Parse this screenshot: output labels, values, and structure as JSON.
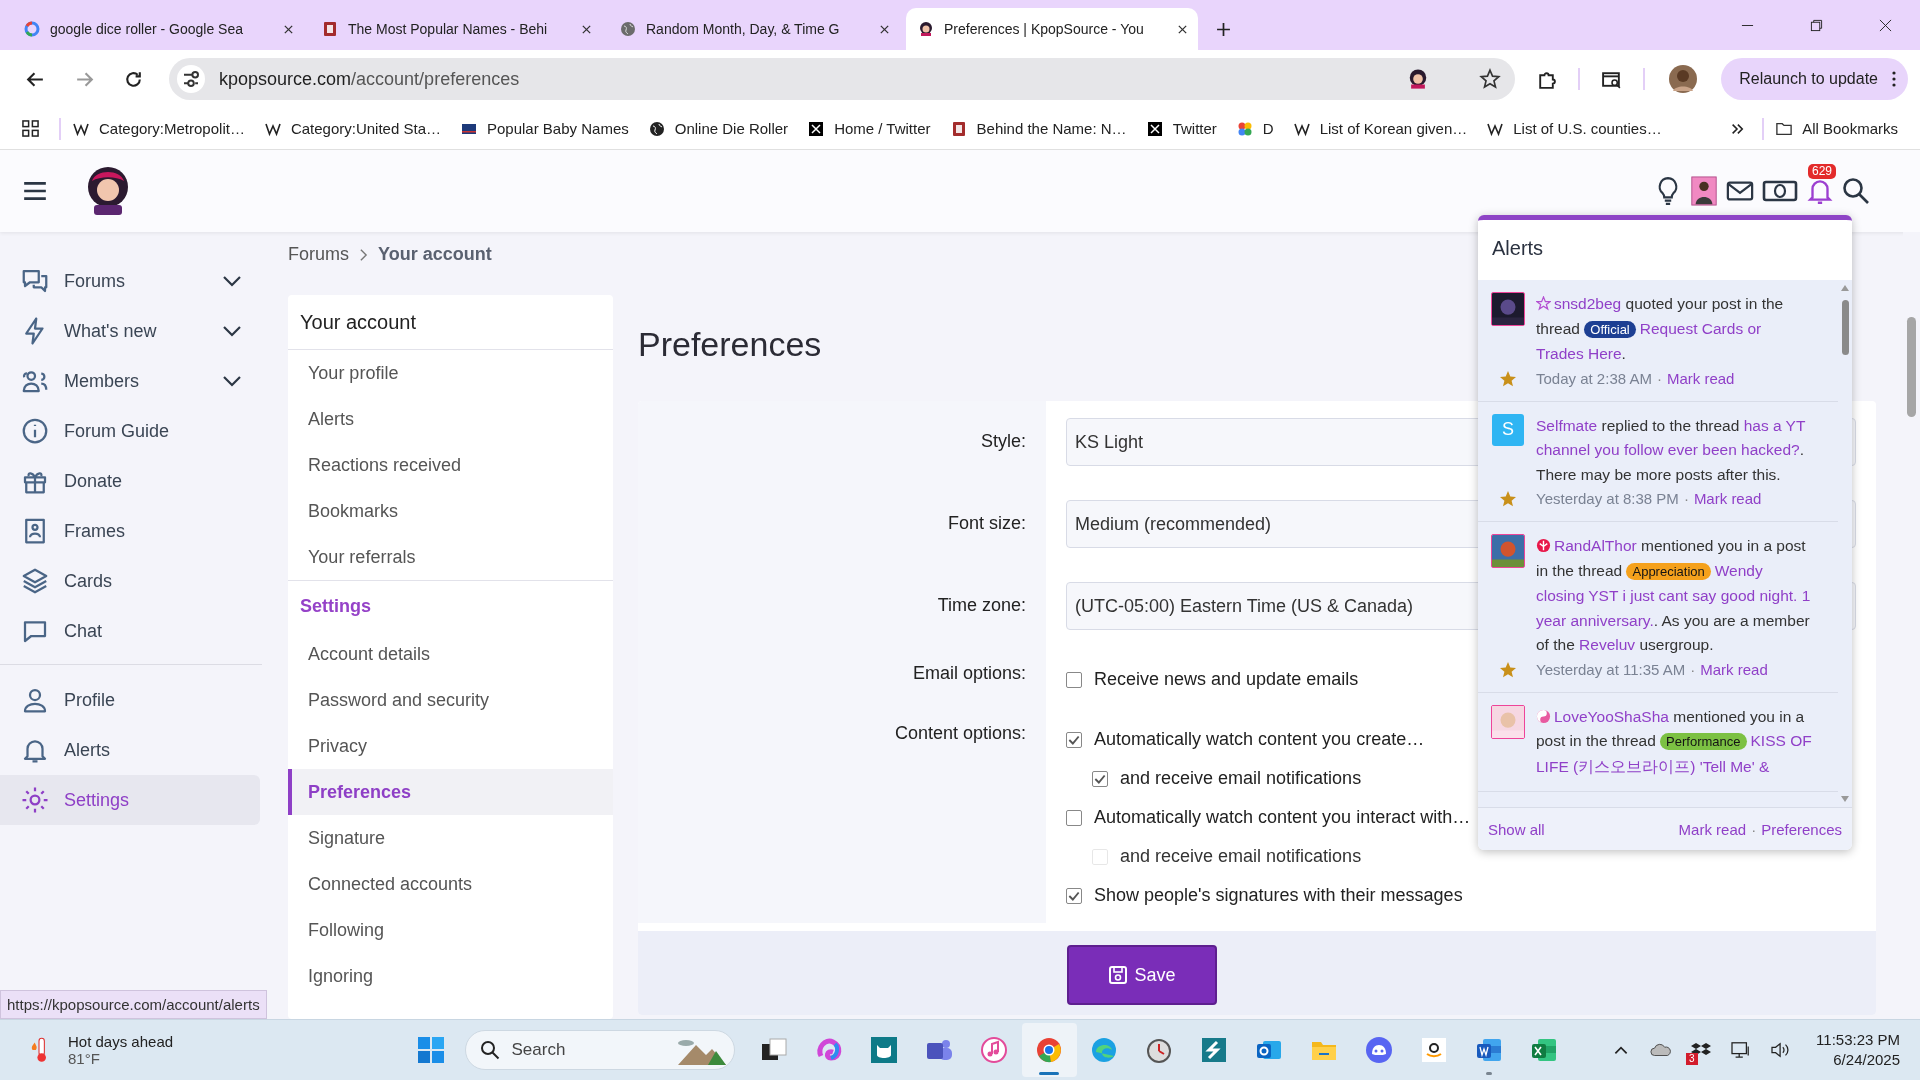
{
  "browser": {
    "tabs": [
      {
        "title": "google dice roller - Google Sea",
        "selected": false
      },
      {
        "title": "The Most Popular Names - Behi",
        "selected": false
      },
      {
        "title": "Random Month, Day, & Time G",
        "selected": false
      },
      {
        "title": "Preferences | KpopSource - You",
        "selected": true
      }
    ],
    "address": {
      "host": "kpopsource.com",
      "path": "/account/preferences"
    },
    "relaunch": "Relaunch to update",
    "bookmarks": [
      {
        "label": "Category:Metropolit…"
      },
      {
        "label": "Category:United Sta…"
      },
      {
        "label": "Popular Baby Names"
      },
      {
        "label": "Online Die Roller"
      },
      {
        "label": "Home / Twitter"
      },
      {
        "label": "Behind the Name: N…"
      },
      {
        "label": "Twitter"
      },
      {
        "label": "D"
      },
      {
        "label": "List of Korean given…"
      },
      {
        "label": "List of U.S. counties…"
      }
    ],
    "all_bookmarks": "All Bookmarks"
  },
  "header": {
    "alert_count": "629"
  },
  "sidebar": {
    "primary": [
      {
        "label": "Forums",
        "expandable": true,
        "selected": false
      },
      {
        "label": "What's new",
        "expandable": true,
        "selected": false
      },
      {
        "label": "Members",
        "expandable": true,
        "selected": false
      },
      {
        "label": "Forum Guide",
        "expandable": false,
        "selected": false
      },
      {
        "label": "Donate",
        "expandable": false,
        "selected": false
      },
      {
        "label": "Frames",
        "expandable": false,
        "selected": false
      },
      {
        "label": "Cards",
        "expandable": false,
        "selected": false
      },
      {
        "label": "Chat",
        "expandable": false,
        "selected": false
      }
    ],
    "account": [
      {
        "label": "Profile",
        "selected": false
      },
      {
        "label": "Alerts",
        "selected": false
      },
      {
        "label": "Settings",
        "selected": true
      }
    ]
  },
  "breadcrumb": [
    {
      "label": "Forums",
      "current": false
    },
    {
      "label": "Your account",
      "current": true
    }
  ],
  "account_nav": {
    "title": "Your account",
    "sections": [
      {
        "items": [
          {
            "label": "Your profile",
            "selected": false
          },
          {
            "label": "Alerts",
            "selected": false
          },
          {
            "label": "Reactions received",
            "selected": false
          },
          {
            "label": "Bookmarks",
            "selected": false
          },
          {
            "label": "Your referrals",
            "selected": false
          }
        ]
      },
      {
        "heading": "Settings",
        "items": [
          {
            "label": "Account details",
            "selected": false
          },
          {
            "label": "Password and security",
            "selected": false
          },
          {
            "label": "Privacy",
            "selected": false
          },
          {
            "label": "Preferences",
            "selected": true
          },
          {
            "label": "Signature",
            "selected": false
          },
          {
            "label": "Connected accounts",
            "selected": false
          },
          {
            "label": "Following",
            "selected": false
          },
          {
            "label": "Ignoring",
            "selected": false
          }
        ]
      }
    ]
  },
  "page_title": "Preferences",
  "form": [
    {
      "kind": "select",
      "label": "Style:",
      "value": "KS Light"
    },
    {
      "kind": "select",
      "label": "Font size:",
      "value": "Medium (recommended)"
    },
    {
      "kind": "select",
      "label": "Time zone:",
      "value": "(UTC-05:00) Eastern Time (US & Canada)"
    },
    {
      "kind": "checkboxes",
      "label": "Email options:",
      "options": [
        {
          "label": "Receive news and update emails",
          "checked": false
        }
      ]
    },
    {
      "kind": "checkboxes",
      "label": "Content options:",
      "options": [
        {
          "label": "Automatically watch content you create…",
          "checked": true,
          "children": [
            {
              "label": "and receive email notifications",
              "checked": true,
              "disabled": false
            }
          ]
        },
        {
          "label": "Automatically watch content you interact with…",
          "checked": false,
          "children": [
            {
              "label": "and receive email notifications",
              "checked": false,
              "disabled": true
            }
          ]
        },
        {
          "label": "Show people's signatures with their messages",
          "checked": true
        }
      ]
    }
  ],
  "save_button": "Save",
  "alerts_popup": {
    "title": "Alerts",
    "items": [
      {
        "avatar": {
          "kind": "picture"
        },
        "parts": [
          {
            "kind": "user",
            "text": "snsd2beg"
          },
          {
            "kind": "plain",
            "text": " quoted your post in the thread "
          },
          {
            "kind": "tag",
            "text": "Official",
            "color": "#1d3f93"
          },
          {
            "kind": "link",
            "text": "Request Cards or Trades Here"
          },
          {
            "kind": "plain",
            "text": "."
          }
        ],
        "time": "Today at 2:38 AM",
        "separator": "·",
        "action": "Mark read"
      },
      {
        "avatar": {
          "kind": "letter",
          "letter": "S",
          "color": "#2fb5f3"
        },
        "parts": [
          {
            "kind": "user",
            "text": "Selfmate"
          },
          {
            "kind": "plain",
            "text": " replied to the thread "
          },
          {
            "kind": "link",
            "text": "has a YT channel you follow ever been hacked?"
          },
          {
            "kind": "plain",
            "text": ". There may be more posts after this."
          }
        ],
        "time": "Yesterday at 8:38 PM",
        "separator": "·",
        "action": "Mark read"
      },
      {
        "avatar": {
          "kind": "picture"
        },
        "parts": [
          {
            "kind": "user",
            "text": "RandAlThor"
          },
          {
            "kind": "plain",
            "text": " mentioned you in a post in the thread "
          },
          {
            "kind": "tag",
            "text": "Appreciation",
            "color": "#f5a11c"
          },
          {
            "kind": "link",
            "text": "Wendy closing YST i just cant say good night. 1 year anniversary."
          },
          {
            "kind": "plain",
            "text": ". As you are a member of the "
          },
          {
            "kind": "link",
            "text": "Reveluv"
          },
          {
            "kind": "plain",
            "text": " usergroup."
          }
        ],
        "time": "Yesterday at 11:35 AM",
        "separator": "·",
        "action": "Mark read"
      },
      {
        "avatar": {
          "kind": "picture"
        },
        "parts": [
          {
            "kind": "user",
            "text": "LoveYooShaSha"
          },
          {
            "kind": "plain",
            "text": " mentioned you in a post in the thread "
          },
          {
            "kind": "tag",
            "text": "Performance",
            "color": "#7cc143"
          },
          {
            "kind": "link",
            "text": "KISS OF LIFE (키스오브라이프) 'Tell Me' &"
          }
        ]
      }
    ],
    "footer": {
      "show_all": "Show all",
      "mark_read": "Mark read",
      "separator": "·",
      "preferences": "Preferences"
    }
  },
  "status_url": "https://kpopsource.com/account/alerts",
  "taskbar": {
    "weather": {
      "title": "Hot days ahead",
      "temp": "81°F"
    },
    "search": {
      "placeholder": "Search"
    },
    "apps": [
      {
        "running": false,
        "selected": false
      },
      {
        "running": false,
        "selected": false
      },
      {
        "running": false,
        "selected": false
      },
      {
        "running": false,
        "selected": false
      },
      {
        "running": false,
        "selected": false
      },
      {
        "running": true,
        "selected": true
      },
      {
        "running": false,
        "selected": false
      },
      {
        "running": false,
        "selected": false
      },
      {
        "running": false,
        "selected": false
      },
      {
        "running": false,
        "selected": false
      },
      {
        "running": false,
        "selected": false
      },
      {
        "running": false,
        "selected": false
      },
      {
        "running": false,
        "selected": false
      },
      {
        "running": true,
        "selected": false
      },
      {
        "running": false,
        "selected": false
      }
    ],
    "dropbox_badge": "3",
    "time": "11:53:23 PM",
    "date": "6/24/2025"
  }
}
